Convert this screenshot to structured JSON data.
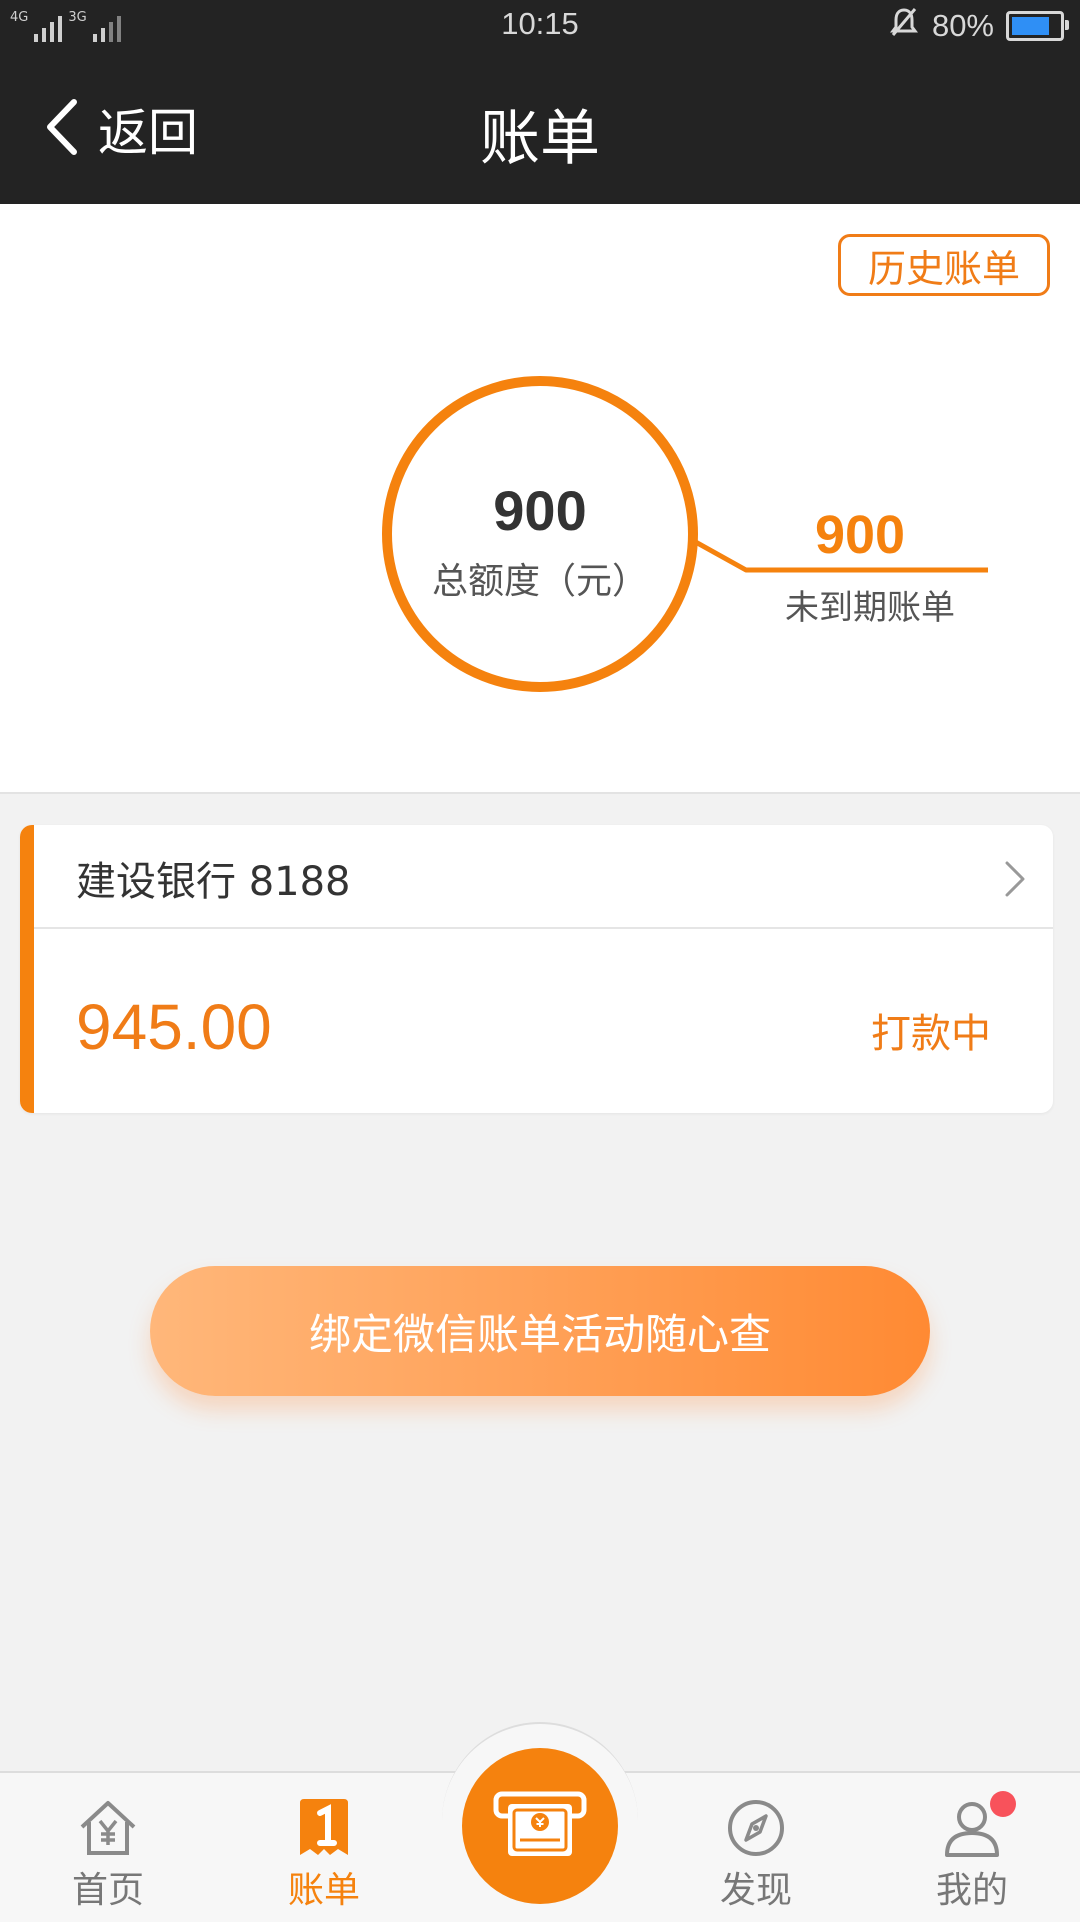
{
  "status_bar": {
    "network_1": "4G",
    "network_2": "3G",
    "time": "10:15",
    "battery_percent": "80%",
    "battery_level": 0.8,
    "icons": [
      "signal-icon",
      "mute-icon",
      "battery-icon"
    ]
  },
  "nav": {
    "back_label": "返回",
    "title": "账单"
  },
  "summary": {
    "history_label": "历史账单",
    "total_amount": "900",
    "total_label": "总额度（元）",
    "due_amount": "900",
    "due_label": "未到期账单"
  },
  "bill_card": {
    "bank": "建设银行 8188",
    "amount": "945.00",
    "status": "打款中"
  },
  "bind_button": {
    "label": "绑定微信账单活动随心查"
  },
  "tabs": [
    {
      "label": "首页",
      "icon": "home-yuan-icon",
      "active": false
    },
    {
      "label": "账单",
      "icon": "bill-icon",
      "active": true
    },
    {
      "label": "",
      "icon": "cash-withdraw-icon",
      "active": false
    },
    {
      "label": "发现",
      "icon": "compass-icon",
      "active": false
    },
    {
      "label": "我的",
      "icon": "user-icon",
      "active": false
    }
  ],
  "colors": {
    "accent": "#f5820e",
    "header_bg": "#232323",
    "page_bg": "#f2f2f2",
    "notification_dot": "#f8525b"
  }
}
